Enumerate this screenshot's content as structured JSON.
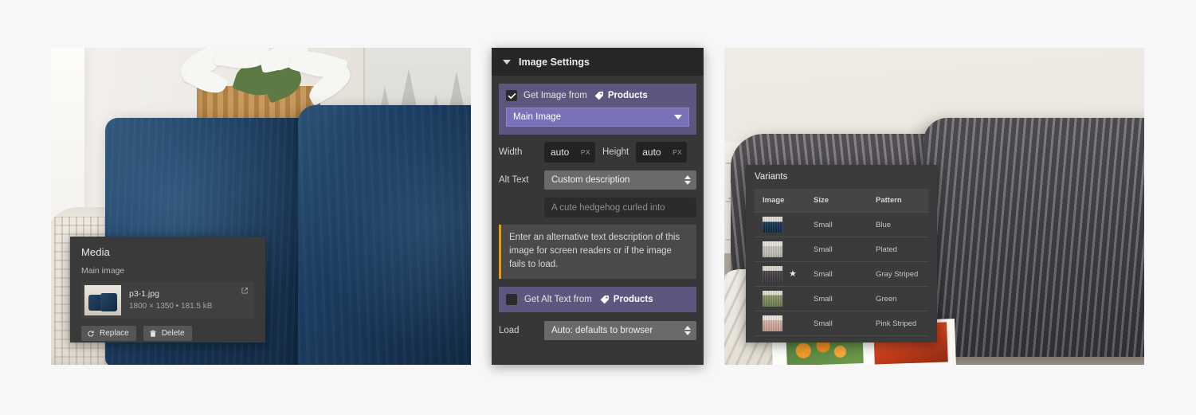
{
  "media_panel": {
    "title": "Media",
    "subtitle": "Main image",
    "file_name": "p3-1.jpg",
    "file_meta": "1800 × 1350 • 181.5 kB",
    "open_external_icon": "external-link-icon",
    "thumbnail_icon": "blue-pillows-thumbnail",
    "replace_label": "Replace",
    "delete_label": "Delete",
    "replace_icon": "refresh-icon",
    "delete_icon": "trash-icon"
  },
  "settings_panel": {
    "header_title": "Image Settings",
    "collapse_icon": "caret-down-icon",
    "get_image": {
      "checkbox_state": "checked",
      "label": "Get Image from",
      "source_label": "Products",
      "source_icon": "tag-icon",
      "selected_option": "Main Image",
      "dropdown_icon": "caret-down-icon"
    },
    "width": {
      "label": "Width",
      "value": "auto",
      "unit": "PX"
    },
    "height": {
      "label": "Height",
      "value": "auto",
      "unit": "PX"
    },
    "alt_text": {
      "label": "Alt Text",
      "selected_option": "Custom description",
      "stepper_icon": "up-down-arrows-icon",
      "input_value": "",
      "input_placeholder": "A cute hedgehog curled into",
      "help_text": "Enter an alternative text description of this image for screen readers or if the image fails to load.",
      "help_accent_color": "#d8a12c"
    },
    "get_alt_text": {
      "checkbox_state": "unchecked",
      "label": "Get Alt Text from",
      "source_label": "Products",
      "source_icon": "tag-icon"
    },
    "load": {
      "label": "Load",
      "selected_option": "Auto: defaults to browser",
      "stepper_icon": "up-down-arrows-icon"
    },
    "accent_purple": "#5d5780",
    "accent_purple_light": "#7a72b8"
  },
  "variants_panel": {
    "title": "Variants",
    "columns": [
      "Image",
      "Size",
      "Pattern"
    ],
    "rows": [
      {
        "thumb": "blue-pillow-thumbnail",
        "starred": false,
        "size": "Small",
        "pattern": "Blue"
      },
      {
        "thumb": "plated-pillow-thumbnail",
        "starred": false,
        "size": "Small",
        "pattern": "Plated"
      },
      {
        "thumb": "gray-striped-pillow-thumbnail",
        "starred": true,
        "size": "Small",
        "pattern": "Gray Striped"
      },
      {
        "thumb": "green-pillow-thumbnail",
        "starred": false,
        "size": "Small",
        "pattern": "Green"
      },
      {
        "thumb": "pink-striped-pillow-thumbnail",
        "starred": false,
        "size": "Small",
        "pattern": "Pink Striped"
      }
    ],
    "star_glyph": "★"
  },
  "photos": {
    "left_alt": "Two navy blue velvet throw pillows on a sofa with a white poinsettia plant in a wicker basket",
    "right_alt": "Two gray ribbed corduroy throw pillows on a sofa with an open magazine"
  }
}
